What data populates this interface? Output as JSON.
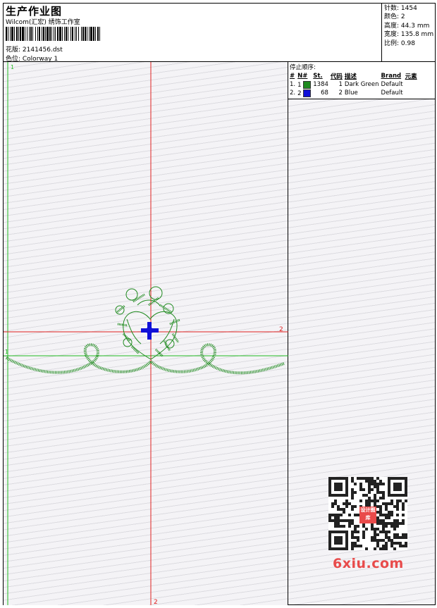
{
  "header": {
    "title": "生产作业图",
    "company": "Wilcom(汇宏) 绣饰工作室",
    "design_label": "花版: 2141456.dst",
    "colorway_label": "色位: Colorway 1"
  },
  "stats": [
    {
      "label": "针数:",
      "value": "1454"
    },
    {
      "label": "颜色:",
      "value": "2"
    },
    {
      "label": "高度:",
      "value": "44.3 mm"
    },
    {
      "label": "宽度:",
      "value": "135.8 mm"
    },
    {
      "label": "比例:",
      "value": "0.98"
    }
  ],
  "stop_sequence": {
    "title": "停止顺序:",
    "headers": [
      "#",
      "N#",
      "St.",
      "代码",
      "描述",
      "Brand",
      "元素"
    ],
    "rows": [
      {
        "index": "1.",
        "needle": "1",
        "color": "#1f8a1f",
        "stitches": "1384",
        "code": "1",
        "description": "Dark Green",
        "brand": "Default"
      },
      {
        "index": "2.",
        "needle": "2",
        "color": "#1010d8",
        "stitches": "68",
        "code": "2",
        "description": "Blue",
        "brand": "Default"
      }
    ]
  },
  "axis_labels": {
    "green_top": "1",
    "green_left": "1",
    "red_right": "2",
    "red_bottom": "2"
  },
  "watermark": {
    "site": "6xiu.com",
    "logo_text": "设计图库"
  },
  "colors": {
    "thread1": "#1f8a1f",
    "thread2": "#1010d8",
    "red_axis": "#e02020",
    "green_axis": "#22bb22"
  }
}
